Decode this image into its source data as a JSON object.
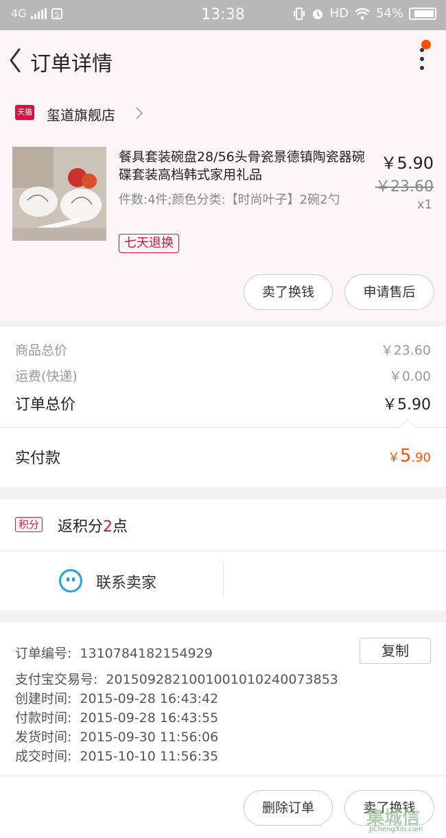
{
  "status_bar": {
    "carrier": "4G",
    "time": "13:38",
    "hd": "HD",
    "battery": "54%"
  },
  "nav": {
    "title": "订单详情"
  },
  "shop": {
    "logo_text": "天猫",
    "name": "玺道旗舰店"
  },
  "item": {
    "title": "餐具套装碗盘28/56头骨瓷景德镇陶瓷器碗碟套装高档韩式家用礼品",
    "spec": "件数:4件;颜色分类:【时尚叶子】2碗2勺",
    "tag": "七天退换",
    "price": "￥5.90",
    "original_price": "￥23.60",
    "quantity": "x1",
    "btn_sell": "卖了换钱",
    "btn_after_sale": "申请售后"
  },
  "summary": {
    "goods_total_label": "商品总价",
    "goods_total_value": "￥23.60",
    "shipping_label": "运费(快递)",
    "shipping_value": "￥0.00",
    "order_total_label": "订单总价",
    "order_total_value": "￥5.90",
    "paid_label": "实付款",
    "paid_currency": "￥",
    "paid_int": "5",
    "paid_dec": ".90"
  },
  "points": {
    "badge": "积分",
    "prefix": "返积分",
    "num": "2",
    "suffix": "点"
  },
  "contact": {
    "label": "联系卖家"
  },
  "order_info": {
    "copy_label": "复制",
    "lines": [
      {
        "key": "订单编号:",
        "value": "1310784182154929"
      },
      {
        "key": "支付宝交易号:",
        "value": "2015092821001001010240073853"
      },
      {
        "key": "创建时间:",
        "value": "2015-09-28 16:43:42"
      },
      {
        "key": "付款时间:",
        "value": "2015-09-28 16:43:55"
      },
      {
        "key": "发货时间:",
        "value": "2015-09-30 11:56:06"
      },
      {
        "key": "成交时间:",
        "value": "2015-10-10 11:56:35"
      }
    ]
  },
  "bottom_actions": {
    "delete_order": "删除订单",
    "sell": "卖了换钱"
  },
  "watermark": {
    "text": "集城信",
    "sub": "JiChengXin.com"
  },
  "colors": {
    "accent": "#ff5000",
    "tmall_red": "#d4143c",
    "wangwang_blue": "#1fa0e8"
  },
  "icons": [
    "back-arrow-icon",
    "more-vertical-icon",
    "tmall-logo-icon",
    "chevron-right-icon",
    "wangwang-icon",
    "signal-icon",
    "wifi-icon",
    "alarm-icon",
    "battery-icon"
  ]
}
